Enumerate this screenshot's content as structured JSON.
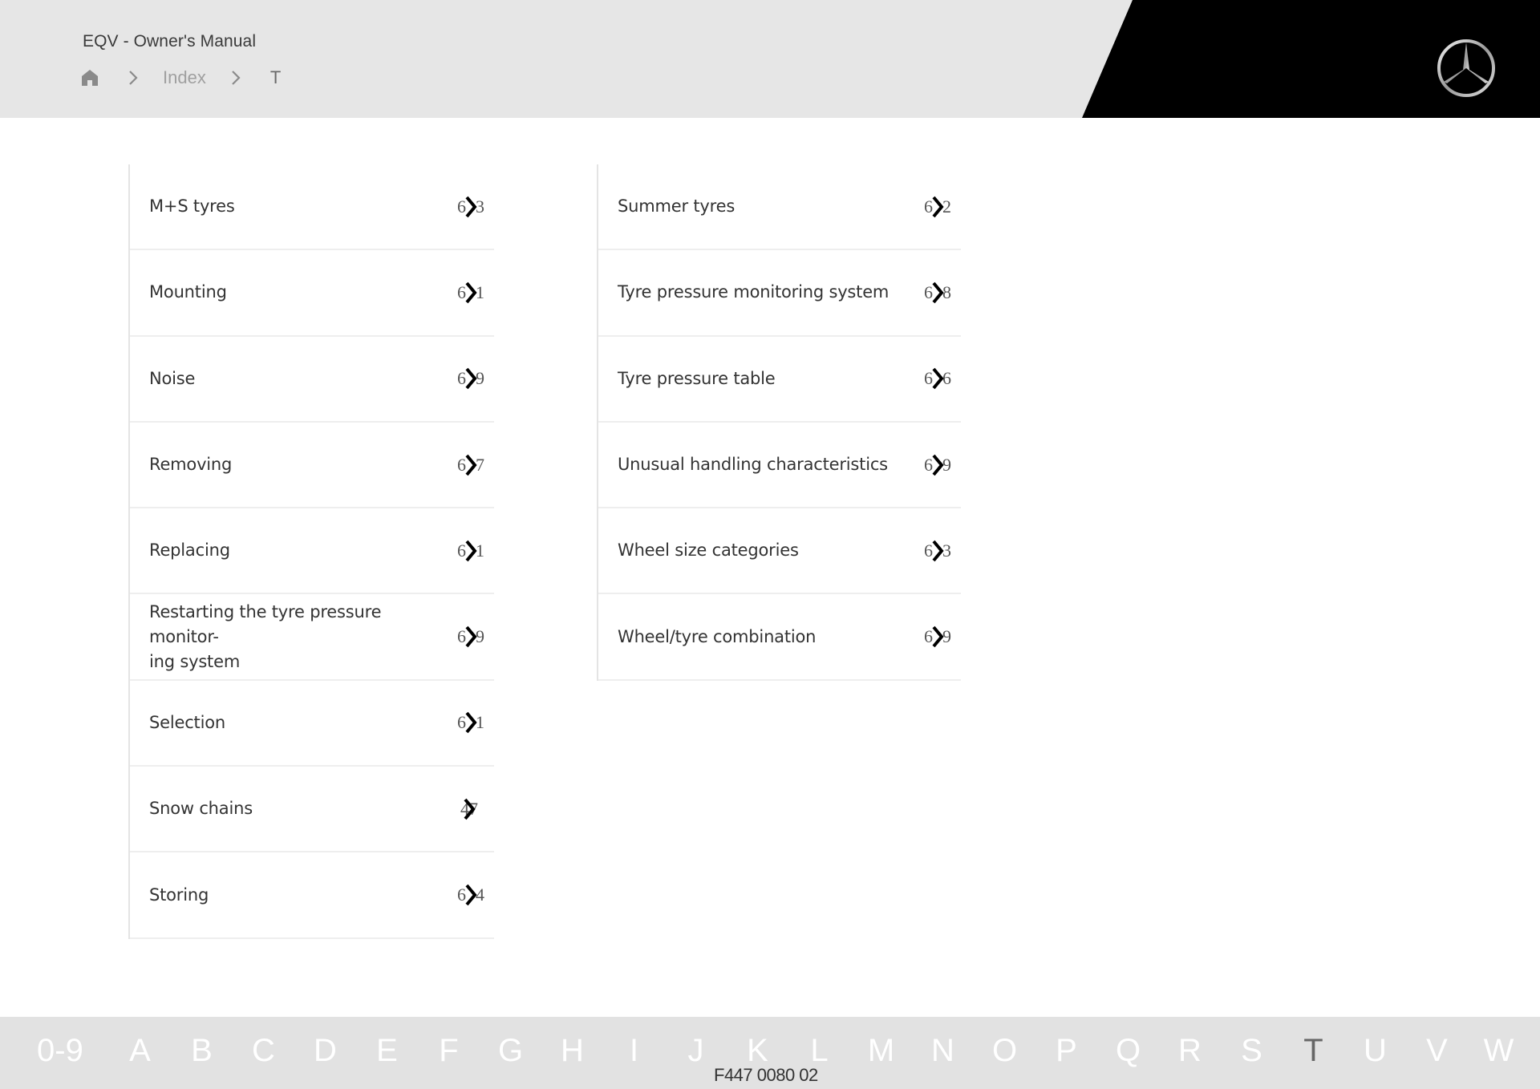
{
  "header": {
    "title": "EQV - Owner's Manual",
    "breadcrumb": {
      "home_icon": "home-icon",
      "separator_icon": "chevron-right-icon",
      "items": [
        "Index",
        "T"
      ]
    },
    "logo": "mercedes-star-logo"
  },
  "index": {
    "columns": [
      {
        "entries": [
          {
            "label": "M+S tyres",
            "page_visible_prefix": "6",
            "page_visible_suffix": "3"
          },
          {
            "label": "Mounting",
            "page_visible_prefix": "6",
            "page_visible_suffix": "1"
          },
          {
            "label": "Noise",
            "page_visible_prefix": "6",
            "page_visible_suffix": "9"
          },
          {
            "label": "Removing",
            "page_visible_prefix": "6",
            "page_visible_suffix": "7"
          },
          {
            "label": "Replacing",
            "page_visible_prefix": "6",
            "page_visible_suffix": "1"
          },
          {
            "label": "Restarting the tyre pressure monitor-ing system",
            "label_line1": "Restarting the tyre pressure monitor-",
            "label_line2": "ing system",
            "page_visible_prefix": "6",
            "page_visible_suffix": "9"
          },
          {
            "label": "Selection",
            "page_visible_prefix": "6",
            "page_visible_suffix": "1"
          },
          {
            "label": "Snow chains",
            "page_visible_prefix": "4",
            "page_visible_suffix": "7"
          },
          {
            "label": "Storing",
            "page_visible_prefix": "6",
            "page_visible_suffix": "4"
          }
        ]
      },
      {
        "entries": [
          {
            "label": "Summer tyres",
            "page_visible_prefix": "6",
            "page_visible_suffix": "2"
          },
          {
            "label": "Tyre pressure monitoring system",
            "page_visible_prefix": "6",
            "page_visible_suffix": "8"
          },
          {
            "label": "Tyre pressure table",
            "page_visible_prefix": "6",
            "page_visible_suffix": "6"
          },
          {
            "label": "Unusual handling characteristics",
            "page_visible_prefix": "6",
            "page_visible_suffix": "9"
          },
          {
            "label": "Wheel size categories",
            "page_visible_prefix": "6",
            "page_visible_suffix": "3"
          },
          {
            "label": "Wheel/tyre combination",
            "page_visible_prefix": "6",
            "page_visible_suffix": "9"
          }
        ]
      }
    ],
    "link_icon": "chevron-right-icon"
  },
  "footer": {
    "alphabet": [
      "0-9",
      "A",
      "B",
      "C",
      "D",
      "E",
      "F",
      "G",
      "H",
      "I",
      "J",
      "K",
      "L",
      "M",
      "N",
      "O",
      "P",
      "Q",
      "R",
      "S",
      "T",
      "U",
      "V",
      "W"
    ],
    "active_letter": "T",
    "document_code": "F447 0080 02"
  },
  "colors": {
    "header_bg": "#e6e6e6",
    "brand_black": "#000000",
    "footer_bg": "#e2e2e2",
    "footer_letter": "#ffffff",
    "footer_active_letter": "#666666",
    "breadcrumb_link": "#a0a0a0"
  }
}
